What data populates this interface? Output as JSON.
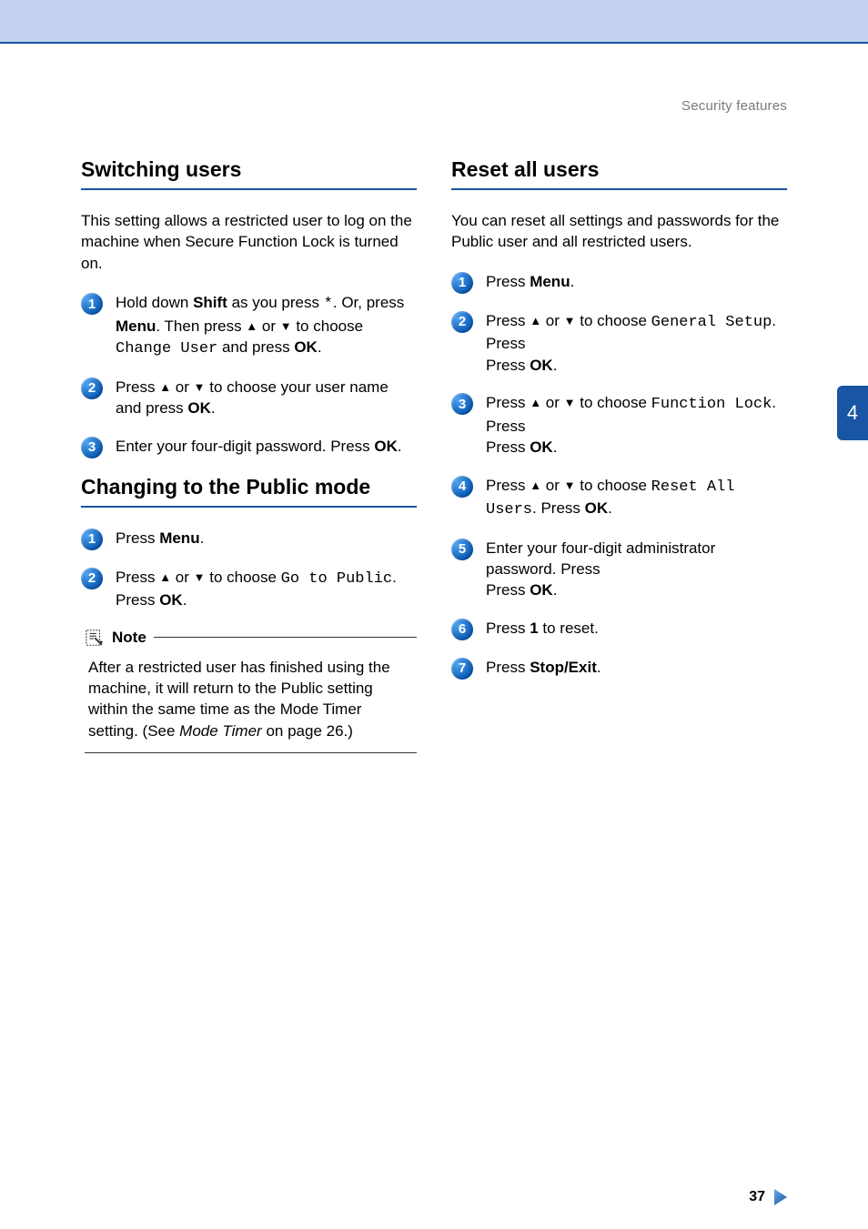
{
  "header": {
    "label": "Security features"
  },
  "sideTab": {
    "label": "4"
  },
  "pageNumber": "37",
  "left": {
    "section1": {
      "title": "Switching users",
      "intro": "This setting allows a restricted user to log on the machine when Secure Function Lock is turned on.",
      "steps": {
        "s1": {
          "t1": "Hold down ",
          "b1": "Shift",
          "t2": " as you press ",
          "ast": "*",
          "t3": ". Or, press ",
          "b2": "Menu",
          "t4": ". Then press ",
          "up": "▲",
          "or": " or ",
          "down": "▼",
          "t5": " to choose ",
          "code": "Change User",
          "t6": " and press ",
          "b3": "OK",
          "t7": "."
        },
        "s2": {
          "t1": "Press ",
          "up": "▲",
          "or": " or ",
          "down": "▼",
          "t2": " to choose your user name and press ",
          "b1": "OK",
          "t3": "."
        },
        "s3": {
          "t1": "Enter your four-digit password. Press ",
          "b1": "OK",
          "t2": "."
        }
      }
    },
    "section2": {
      "title": "Changing to the Public mode",
      "steps": {
        "s1": {
          "t1": "Press ",
          "b1": "Menu",
          "t2": "."
        },
        "s2": {
          "t1": "Press ",
          "up": "▲",
          "or": " or ",
          "down": "▼",
          "t2": " to choose ",
          "code": "Go to Public",
          "t3": ". Press ",
          "b1": "OK",
          "t4": "."
        }
      },
      "note": {
        "label": "Note",
        "body1": "After a restricted user has finished using the machine, it will return to the Public setting within the same time as the Mode Timer setting. (See ",
        "italic": "Mode Timer",
        "body2": " on page 26.)"
      }
    }
  },
  "right": {
    "section1": {
      "title": "Reset all users",
      "intro": "You can reset all settings and passwords for the Public user and all restricted users.",
      "steps": {
        "s1": {
          "t1": "Press ",
          "b1": "Menu",
          "t2": "."
        },
        "s2": {
          "t1": "Press ",
          "up": "▲",
          "or": " or ",
          "down": "▼",
          "t2": " to choose ",
          "code": "General Setup",
          "t3": ". Press ",
          "b1": "OK",
          "t4": "."
        },
        "s3": {
          "t1": "Press ",
          "up": "▲",
          "or": " or ",
          "down": "▼",
          "t2": " to choose ",
          "code": "Function Lock",
          "t3": ". Press ",
          "b1": "OK",
          "t4": "."
        },
        "s4": {
          "t1": "Press ",
          "up": "▲",
          "or": " or ",
          "down": "▼",
          "t2": " to choose ",
          "code": "Reset All Users",
          "t3": ". Press ",
          "b1": "OK",
          "t4": "."
        },
        "s5": {
          "t1": "Enter your four-digit administrator password. Press ",
          "b1": "OK",
          "t2": "."
        },
        "s6": {
          "t1": "Press ",
          "b1": "1",
          "t2": " to reset."
        },
        "s7": {
          "t1": "Press ",
          "b1": "Stop/Exit",
          "t2": "."
        }
      }
    }
  }
}
